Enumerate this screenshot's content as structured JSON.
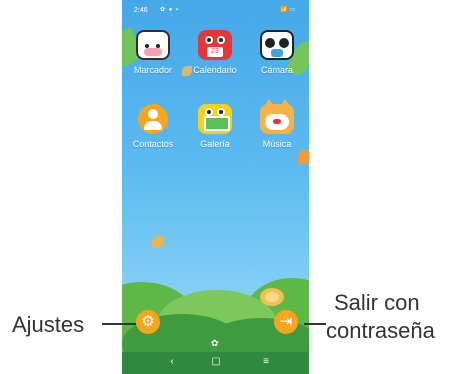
{
  "status_bar": {
    "time": "2:46",
    "indicators": "✿ ● ▪",
    "right_icons": "📶 ▭"
  },
  "apps": [
    {
      "label": "Marcador"
    },
    {
      "label": "Calendario",
      "badge": "23"
    },
    {
      "label": "Cámara"
    },
    {
      "label": "Contactos"
    },
    {
      "label": "Galería"
    },
    {
      "label": "Música"
    }
  ],
  "dock": {
    "settings_icon": "gear-icon",
    "exit_icon": "exit-icon",
    "center_icon": "paw-icon"
  },
  "navbar": {
    "back": "‹",
    "home": "▢",
    "menu": "≡"
  },
  "callouts": {
    "settings": "Ajustes",
    "exit_line1": "Salir con",
    "exit_line2": "contraseña"
  },
  "colors": {
    "accent": "#f7a51e",
    "sky": "#44a9e8",
    "grass": "#2f8a3f"
  }
}
